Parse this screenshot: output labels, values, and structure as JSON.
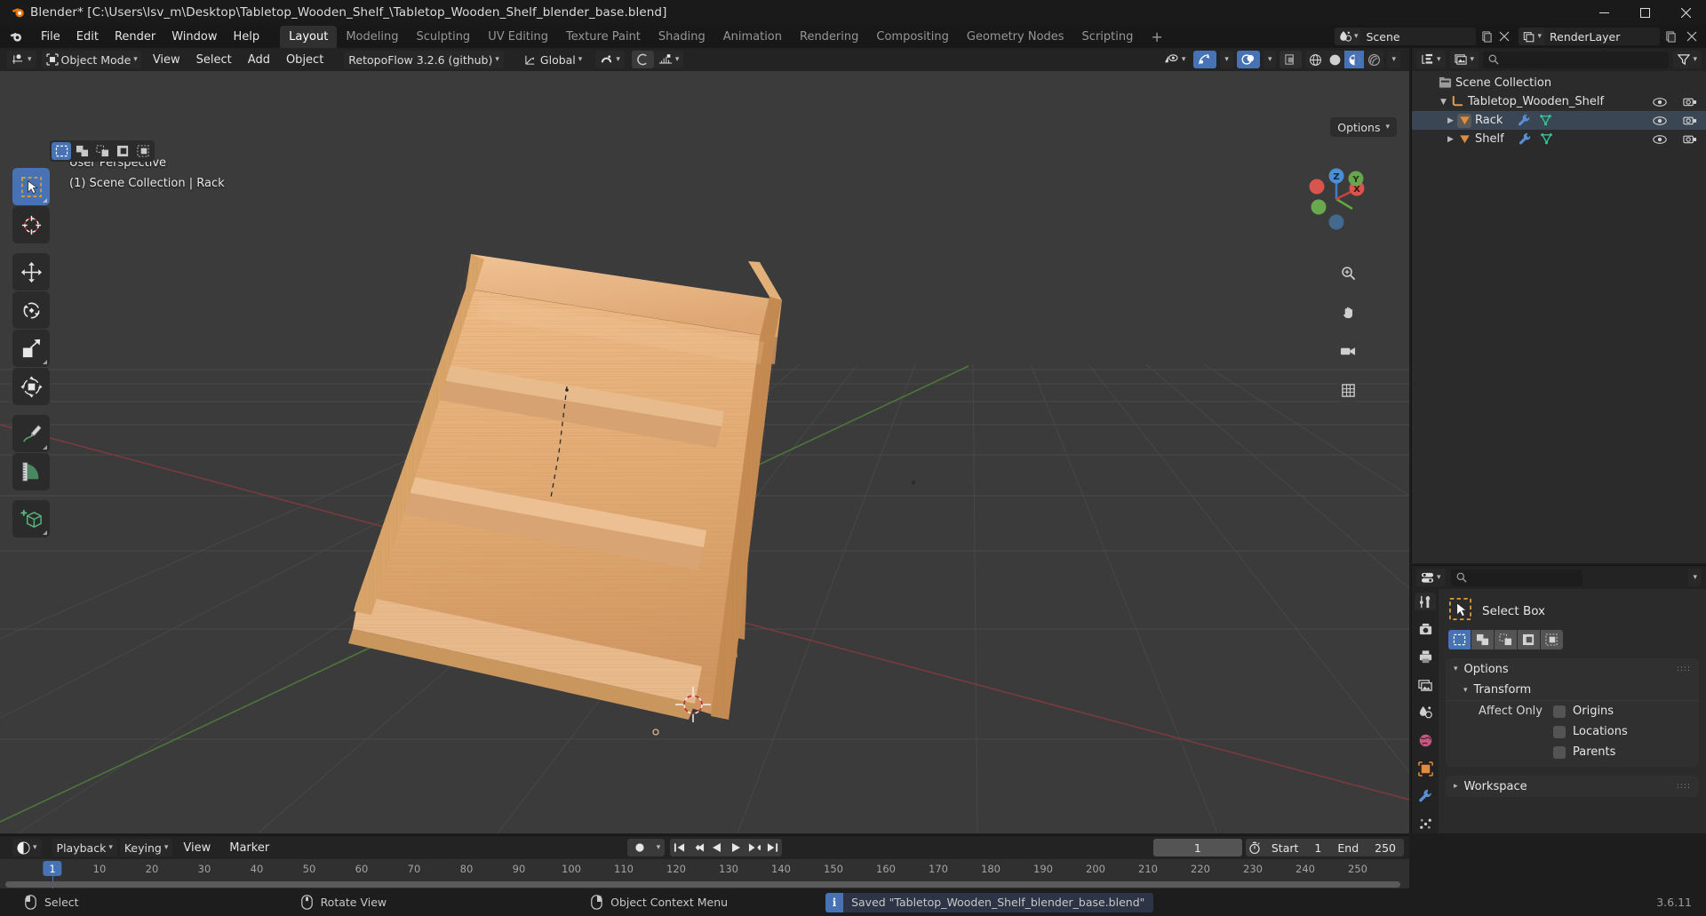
{
  "window": {
    "title": "Blender* [C:\\Users\\lsv_m\\Desktop\\Tabletop_Wooden_Shelf_\\Tabletop_Wooden_Shelf_blender_base.blend]",
    "minimize": "minimize-icon",
    "maximize": "maximize-icon",
    "close": "close-icon"
  },
  "topbar": {
    "menus": [
      "File",
      "Edit",
      "Render",
      "Window",
      "Help"
    ],
    "workspaces": [
      {
        "label": "Layout",
        "active": true
      },
      {
        "label": "Modeling",
        "active": false
      },
      {
        "label": "Sculpting",
        "active": false
      },
      {
        "label": "UV Editing",
        "active": false
      },
      {
        "label": "Texture Paint",
        "active": false
      },
      {
        "label": "Shading",
        "active": false
      },
      {
        "label": "Animation",
        "active": false
      },
      {
        "label": "Rendering",
        "active": false
      },
      {
        "label": "Compositing",
        "active": false
      },
      {
        "label": "Geometry Nodes",
        "active": false
      },
      {
        "label": "Scripting",
        "active": false
      }
    ],
    "add_workspace": "+",
    "scene_name": "Scene",
    "view_layer_name": "RenderLayer"
  },
  "viewport": {
    "header": {
      "editor_type": "editor-type-icon",
      "mode": "Object Mode",
      "menus": [
        "View",
        "Select",
        "Add",
        "Object"
      ],
      "addon_menu": "RetopoFlow 3.2.6 (github)",
      "transform_orientation": "Global",
      "snap": "snap-magnet-icon",
      "proportional": "proportional-editing-icon"
    },
    "overlay_line1": "User Perspective",
    "overlay_line2": "(1) Scene Collection | Rack",
    "options_label": "Options",
    "select_modes": [
      "tweak",
      "box-select",
      "circle-select",
      "lasso-select",
      "select-all"
    ],
    "tools": [
      "select-box-tool",
      "cursor-tool",
      "move-tool",
      "rotate-tool",
      "scale-tool",
      "transform-tool",
      "annotate-tool",
      "measure-tool",
      "add-cube-tool"
    ],
    "gizmo_axes": [
      "Z",
      "Y",
      "X"
    ],
    "nav_buttons": [
      "zoom-icon",
      "pan-hand-icon",
      "camera-view-icon",
      "toggle-ortho-icon"
    ],
    "shading_modes": [
      "wireframe",
      "solid",
      "material-preview",
      "rendered"
    ],
    "shading_active": "material-preview"
  },
  "outliner": {
    "display_mode": "outliner-display-mode-icon",
    "filter_id": "blender-file-icon",
    "search_placeholder": "",
    "filter_icon": "filter-funnel-icon",
    "rows": [
      {
        "name": "Scene Collection",
        "indent": 0,
        "icon": "collection-icon",
        "disclosure": "",
        "selected": false,
        "show_eye": false,
        "show_cam": false
      },
      {
        "name": "Tabletop_Wooden_Shelf",
        "indent": 1,
        "icon": "armature-empty-icon",
        "disclosure": "down",
        "selected": false,
        "show_eye": true,
        "show_cam": true
      },
      {
        "name": "Rack",
        "indent": 2,
        "icon": "mesh-object-icon",
        "disclosure": "right",
        "selected": true,
        "show_eye": true,
        "show_cam": true,
        "extra": [
          "modifier-wrench-icon",
          "mesh-data-icon"
        ]
      },
      {
        "name": "Shelf",
        "indent": 2,
        "icon": "mesh-object-icon",
        "disclosure": "right",
        "selected": false,
        "show_eye": true,
        "show_cam": true,
        "extra": [
          "modifier-wrench-icon",
          "mesh-data-icon"
        ]
      }
    ]
  },
  "properties": {
    "editor_icon": "properties-editor-icon",
    "search_placeholder": "",
    "tabs": [
      "tool-tab",
      "render-tab",
      "output-tab",
      "view-layer-tab",
      "scene-tab",
      "world-tab",
      "object-tab",
      "modifier-tab",
      "particles-tab"
    ],
    "active_tab": "tool-tab",
    "active_tool": "Select Box",
    "tool_icon": "select-box-icon",
    "mode_buttons": [
      "set-new-selection",
      "extend-selection",
      "subtract-selection",
      "invert-selection",
      "intersect-selection"
    ],
    "mode_active_index": 0,
    "panels": [
      {
        "title": "Options",
        "open": true,
        "sub": {
          "title": "Transform",
          "open": true,
          "label": "Affect Only",
          "checkboxes": [
            {
              "label": "Origins",
              "checked": false
            },
            {
              "label": "Locations",
              "checked": false
            },
            {
              "label": "Parents",
              "checked": false
            }
          ]
        }
      },
      {
        "title": "Workspace",
        "open": false
      }
    ]
  },
  "timeline": {
    "editor_icon": "timeline-editor-icon",
    "menus": [
      "Playback",
      "Keying",
      "View",
      "Marker"
    ],
    "record_icon": "auto-keying-record-icon",
    "transport": [
      "jump-to-start",
      "jump-prev-keyframe",
      "play-reverse",
      "play",
      "jump-next-keyframe",
      "jump-to-end"
    ],
    "current_frame": "1",
    "timer_icon": "use-preview-range-icon",
    "start_label": "Start",
    "start_value": "1",
    "end_label": "End",
    "end_value": "250",
    "ticks": [
      10,
      20,
      30,
      40,
      50,
      60,
      70,
      80,
      90,
      100,
      110,
      120,
      130,
      140,
      150,
      160,
      170,
      180,
      190,
      200,
      210,
      220,
      230,
      240,
      250
    ],
    "playhead_frame": "1"
  },
  "statusbar": {
    "items": [
      {
        "icon": "mouse-left-icon",
        "label": "Select"
      },
      {
        "icon": "mouse-middle-icon",
        "label": "Rotate View"
      },
      {
        "icon": "mouse-right-icon",
        "label": "Object Context Menu"
      }
    ],
    "report": "Saved \"Tabletop_Wooden_Shelf_blender_base.blend\"",
    "report_icon": "info-icon",
    "version": "3.6.11"
  },
  "colors": {
    "accent_blue": "#4772b3",
    "viewport_bg": "#3b3b3b",
    "panel_bg": "#2b2b2b",
    "header_bg": "#232323",
    "wood_light": "#e8b37b",
    "wood_mid": "#d49a5f",
    "wood_dark": "#b87c44"
  }
}
